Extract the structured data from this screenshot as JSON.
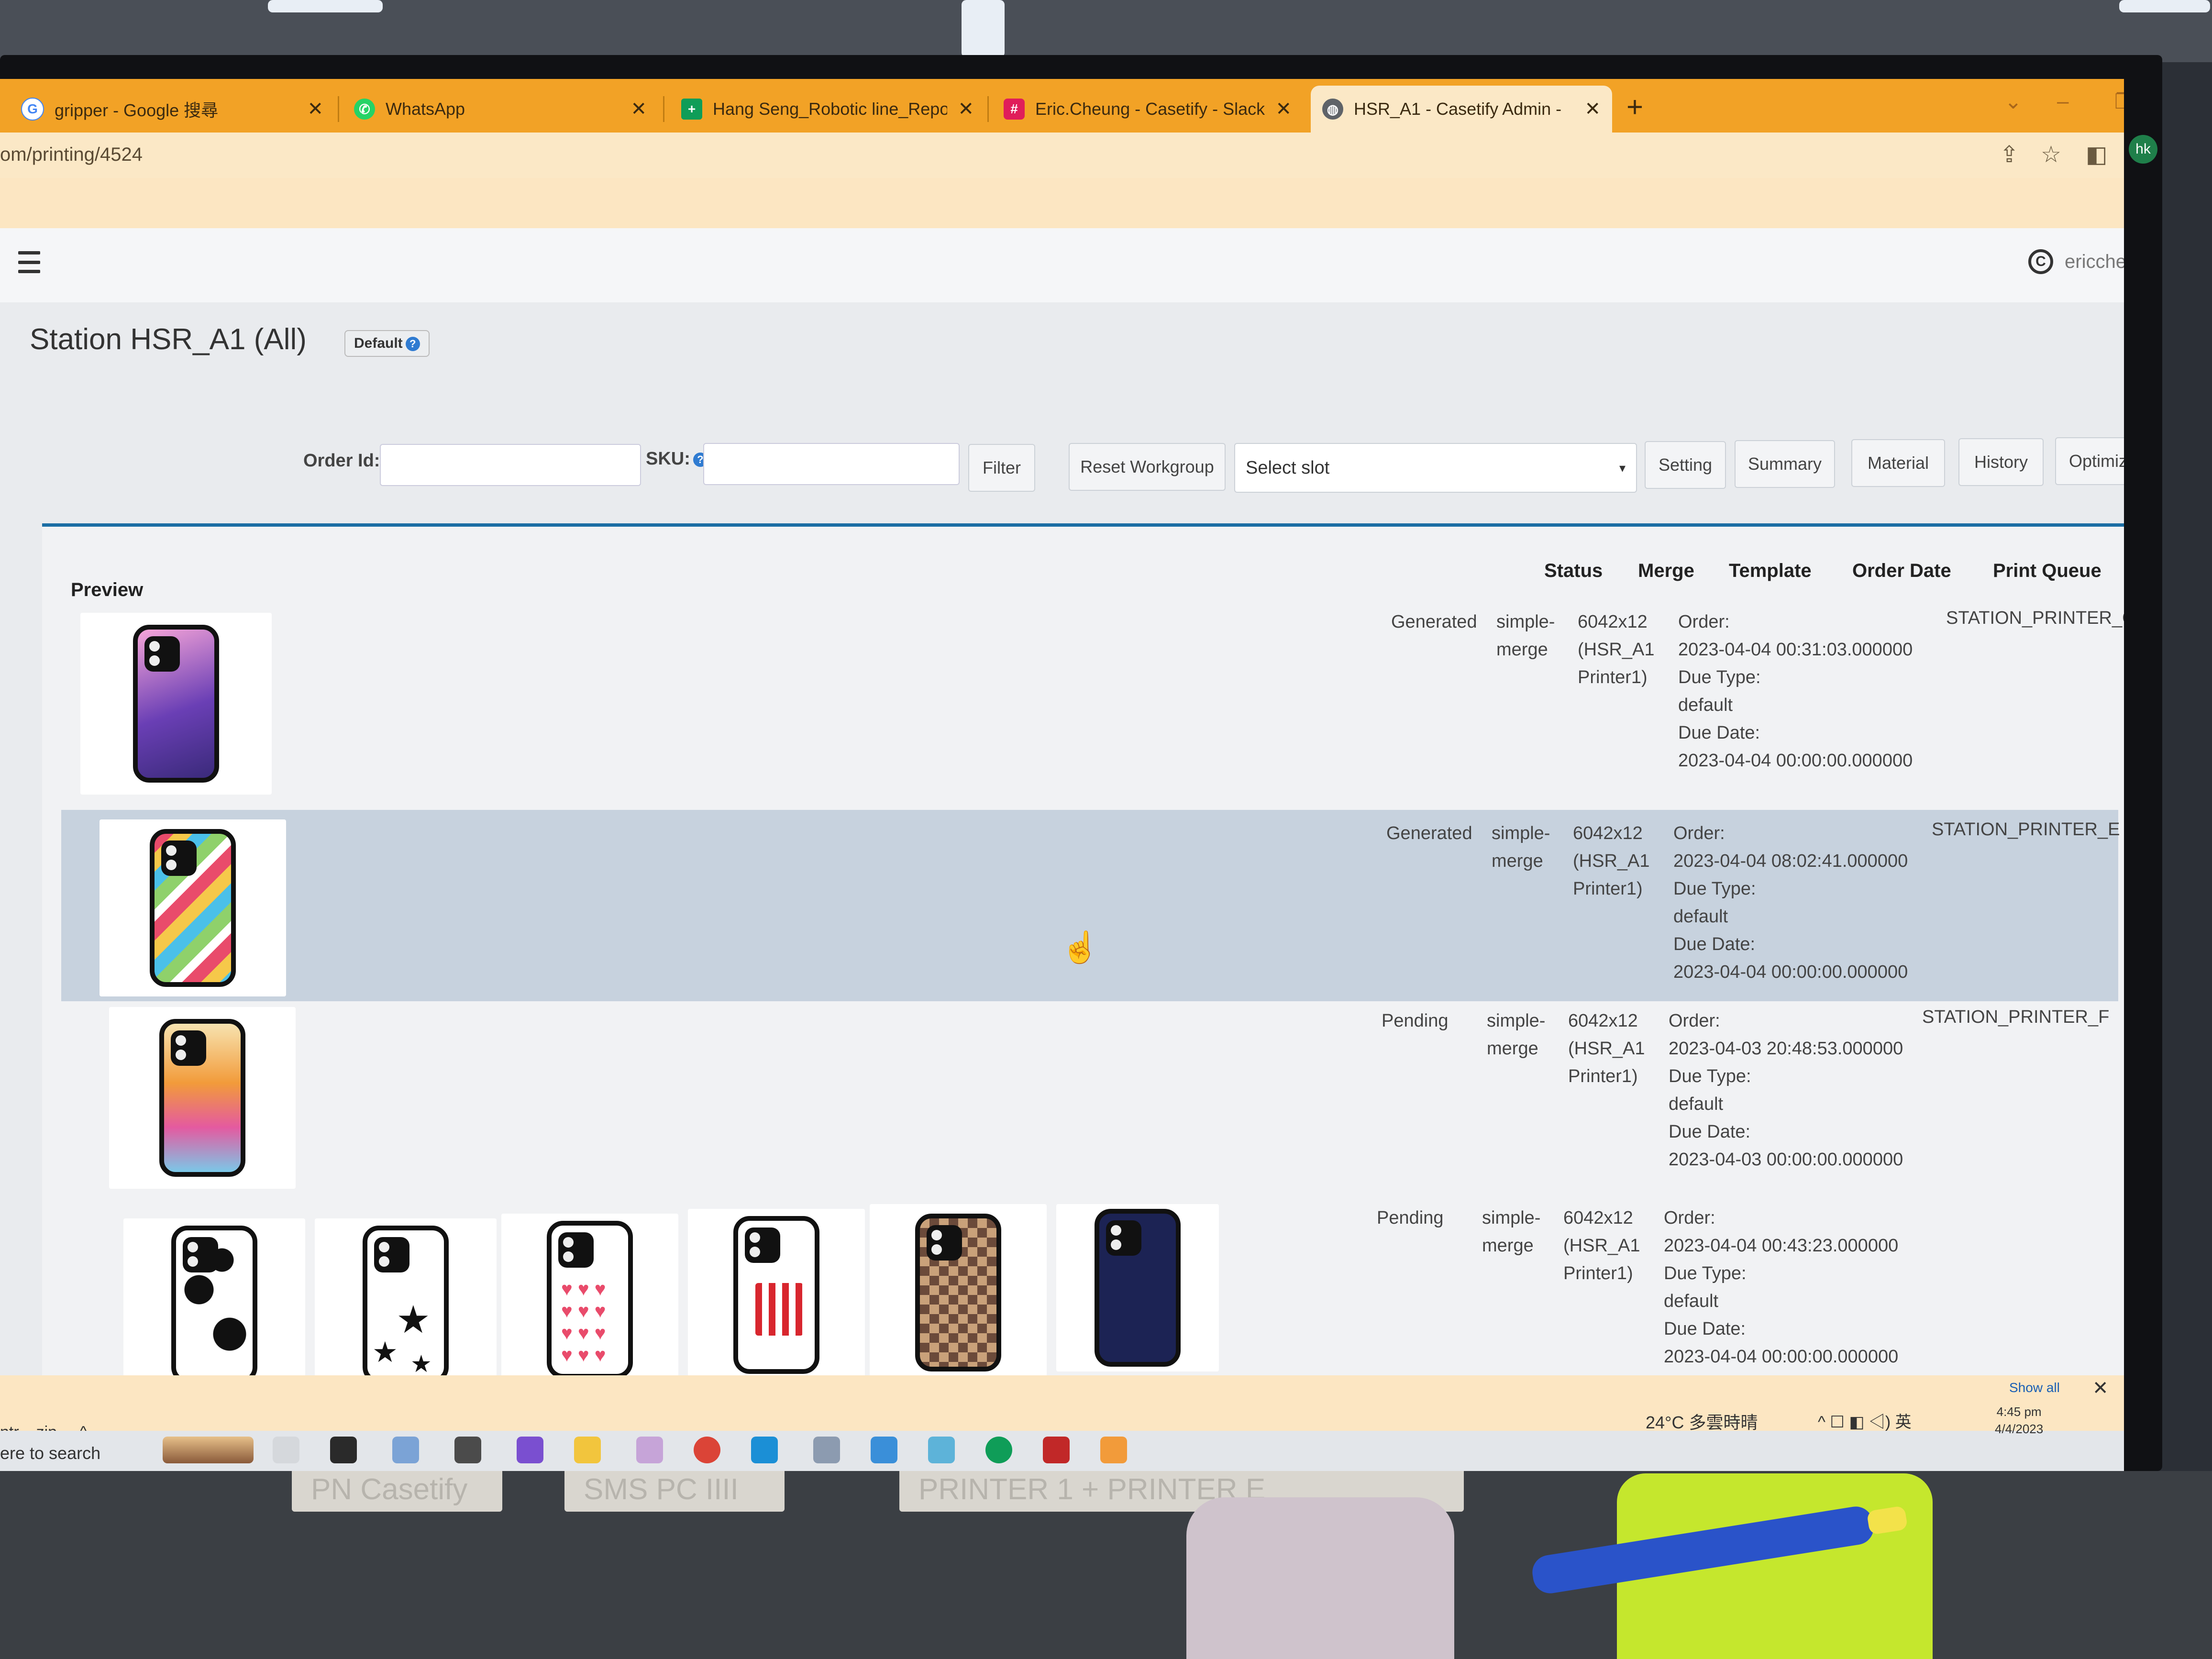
{
  "browser": {
    "tabs": [
      {
        "title": "gripper - Google 搜尋",
        "icon": "google-icon",
        "color": "#4285f4"
      },
      {
        "title": "WhatsApp",
        "icon": "whatsapp-icon",
        "color": "#25d366"
      },
      {
        "title": "Hang Seng_Robotic line_Report.",
        "icon": "sheets-icon",
        "color": "#0f9d58"
      },
      {
        "title": "Eric.Cheung - Casetify - Slack",
        "icon": "slack-icon",
        "color": "#e01e5a"
      },
      {
        "title": "HSR_A1 - Casetify Admin -",
        "icon": "globe-icon",
        "color": "#5f6368",
        "active": true
      }
    ],
    "close_glyph": "✕",
    "new_tab_glyph": "+",
    "url": "om/printing/4524",
    "profile_initials": "hk",
    "accent_color": "#f2a226"
  },
  "header": {
    "username": "ericcheung",
    "logo_letter": "C"
  },
  "page": {
    "title": "Station HSR_A1 (All)",
    "default_badge": "Default",
    "help_glyph": "?",
    "order_id_label": "Order Id:",
    "sku_label": "SKU:",
    "filter_button": "Filter",
    "reset_workgroup_button": "Reset Workgroup",
    "select_slot_placeholder": "Select slot",
    "select_caret": "▾",
    "buttons": {
      "setting": "Setting",
      "summary": "Summary",
      "material": "Material",
      "history": "History",
      "optimize": "Optimize"
    },
    "divider_color": "#1c6ea4"
  },
  "table": {
    "headers": {
      "preview": "Preview",
      "status": "Status",
      "merge": "Merge",
      "template": "Template",
      "order_date": "Order Date",
      "print_queue": "Print Queue"
    },
    "rows": [
      {
        "status": "Generated",
        "merge_1": "simple-",
        "merge_2": "merge",
        "template_1": "6042x12",
        "template_2": "(HSR_A1",
        "template_3": "Printer1)",
        "order_label": "Order:",
        "order_date": "2023-04-04 00:31:03.000000",
        "due_type_label": "Due Type:",
        "due_type": "default",
        "due_date_label": "Due Date:",
        "due_date": "2023-04-04 00:00:00.000000",
        "print_queue": "STATION_PRINTER_G"
      },
      {
        "status": "Generated",
        "merge_1": "simple-",
        "merge_2": "merge",
        "template_1": "6042x12",
        "template_2": "(HSR_A1",
        "template_3": "Printer1)",
        "order_label": "Order:",
        "order_date": "2023-04-04 08:02:41.000000",
        "due_type_label": "Due Type:",
        "due_type": "default",
        "due_date_label": "Due Date:",
        "due_date": "2023-04-04 00:00:00.000000",
        "print_queue": "STATION_PRINTER_E"
      },
      {
        "status": "Pending",
        "merge_1": "simple-",
        "merge_2": "merge",
        "template_1": "6042x12",
        "template_2": "(HSR_A1",
        "template_3": "Printer1)",
        "order_label": "Order:",
        "order_date": "2023-04-03 20:48:53.000000",
        "due_type_label": "Due Type:",
        "due_type": "default",
        "due_date_label": "Due Date:",
        "due_date": "2023-04-03 00:00:00.000000",
        "print_queue": "STATION_PRINTER_F"
      },
      {
        "status": "Pending",
        "merge_1": "simple-",
        "merge_2": "merge",
        "template_1": "6042x12",
        "template_2": "(HSR_A1",
        "template_3": "Printer1)",
        "order_label": "Order:",
        "order_date": "2023-04-04 00:43:23.000000",
        "due_type_label": "Due Type:",
        "due_type": "default",
        "due_date_label": "Due Date:",
        "due_date": "2023-04-04 00:00:00.000000",
        "print_queue": ""
      }
    ]
  },
  "shelf": {
    "show_all": "Show all",
    "close_glyph": "✕",
    "download_item": "ntr....zip",
    "chevron": "^"
  },
  "taskbar": {
    "search_text": "ere to search",
    "weather": "24°C 多雲時晴",
    "tray": "^ ☐ ◧ ◁) 英",
    "time": "4:45 pm",
    "date": "4/4/2023"
  },
  "desk": {
    "tape_1": "PN Casetify",
    "tape_2": "SMS PC IIII",
    "tape_3": "PRINTER 1 + PRINTER E"
  }
}
